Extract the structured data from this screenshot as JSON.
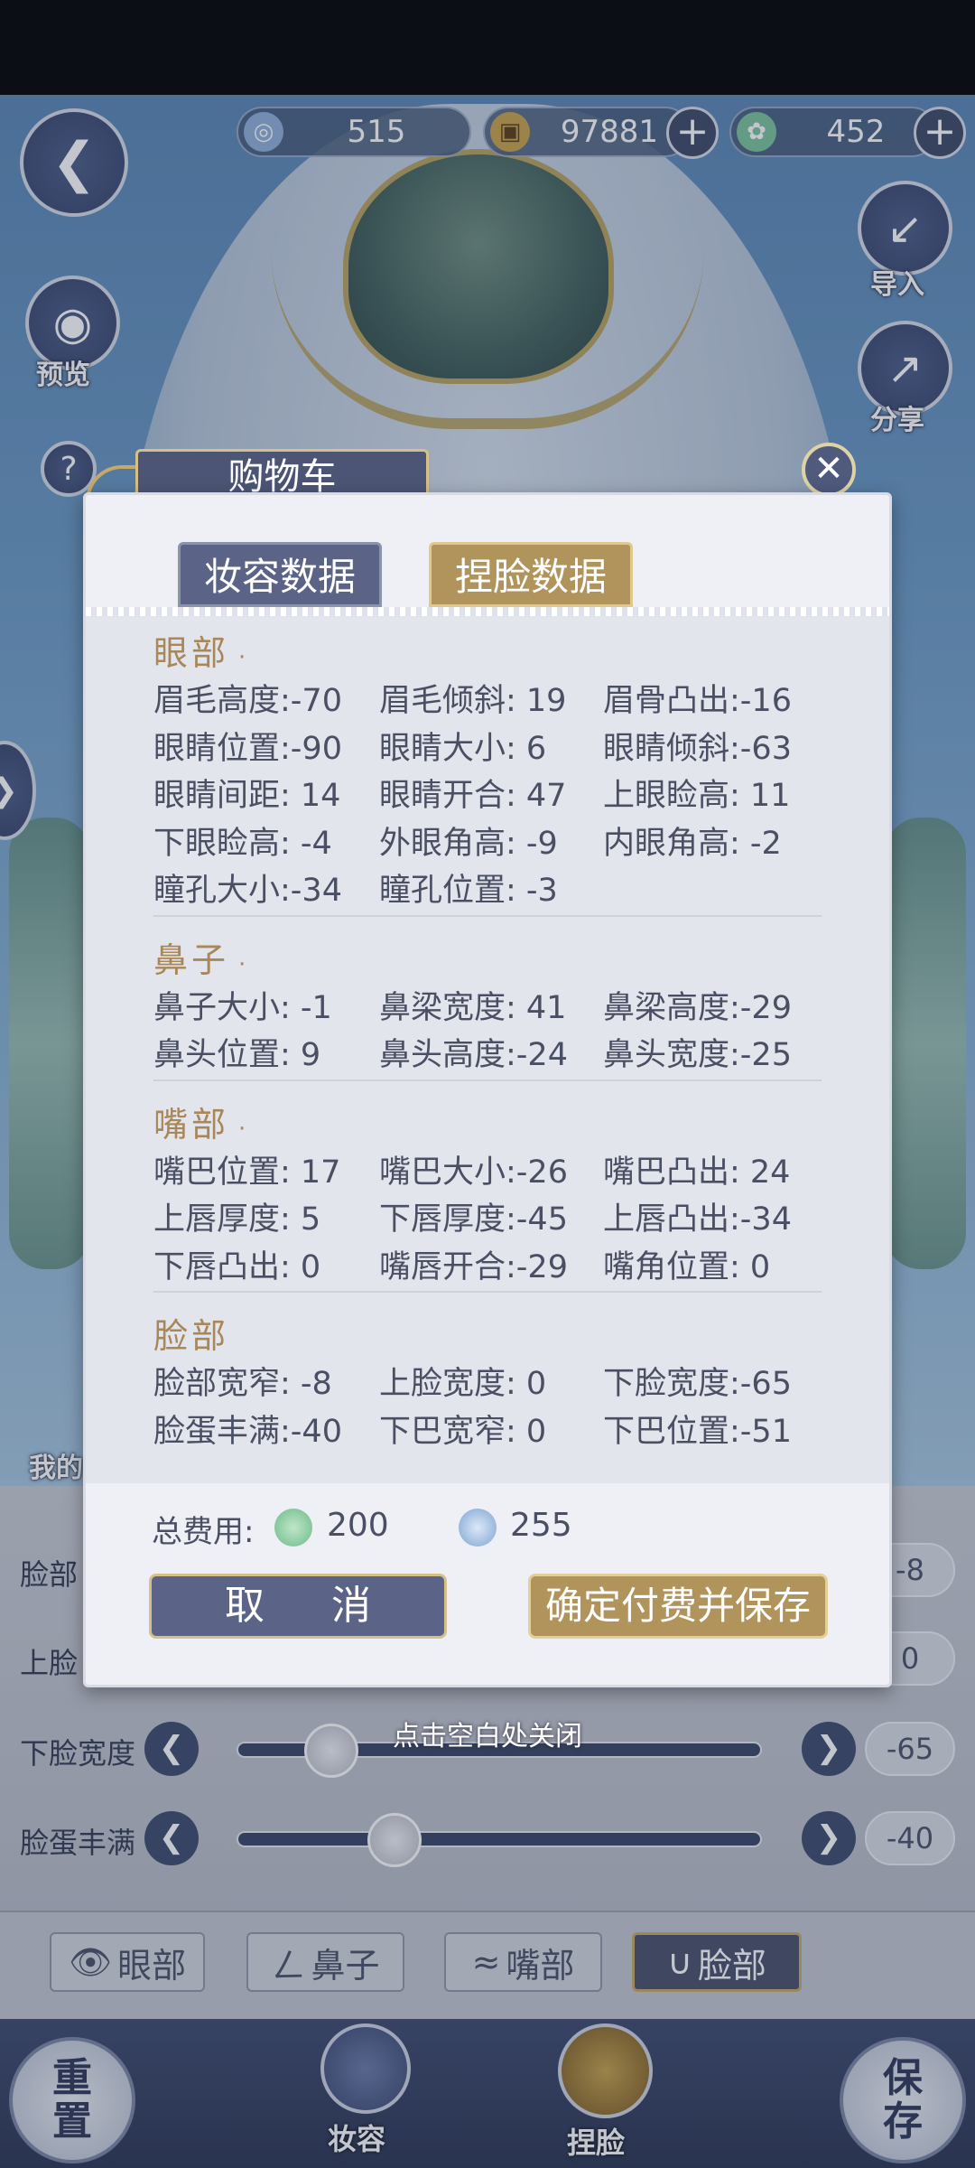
{
  "currency": [
    {
      "icon": "swirl-gem-icon",
      "value": "515"
    },
    {
      "icon": "coin-icon",
      "value": "97881"
    },
    {
      "icon": "jade-icon",
      "value": "452"
    }
  ],
  "side_buttons": {
    "preview": "预览",
    "import": "导入",
    "share": "分享",
    "help": "?",
    "mine_partial": "我的"
  },
  "dialog": {
    "title": "购物车",
    "close_symbol": "✕",
    "tabs": [
      "妆容数据",
      "捏脸数据"
    ],
    "active_tab": 1,
    "sections": [
      {
        "title": "眼部",
        "dot": "·",
        "rows": [
          [
            "眉毛高度:-70",
            "眉毛倾斜: 19",
            "眉骨凸出:-16"
          ],
          [
            "眼睛位置:-90",
            "眼睛大小:  6",
            "眼睛倾斜:-63"
          ],
          [
            "眼睛间距: 14",
            "眼睛开合: 47",
            "上眼睑高: 11"
          ],
          [
            "下眼睑高: -4",
            "外眼角高: -9",
            "内眼角高: -2"
          ],
          [
            "瞳孔大小:-34",
            "瞳孔位置: -3"
          ]
        ]
      },
      {
        "title": "鼻子",
        "dot": "·",
        "rows": [
          [
            "鼻子大小: -1",
            "鼻梁宽度: 41",
            "鼻梁高度:-29"
          ],
          [
            "鼻头位置:  9",
            "鼻头高度:-24",
            "鼻头宽度:-25"
          ]
        ]
      },
      {
        "title": "嘴部",
        "dot": "·",
        "rows": [
          [
            "嘴巴位置: 17",
            "嘴巴大小:-26",
            "嘴巴凸出: 24"
          ],
          [
            "上唇厚度:  5",
            "下唇厚度:-45",
            "上唇凸出:-34"
          ],
          [
            "下唇凸出:  0",
            "嘴唇开合:-29",
            "嘴角位置:  0"
          ]
        ]
      },
      {
        "title": "脸部",
        "dot": "",
        "rows": [
          [
            "脸部宽窄: -8",
            "上脸宽度:  0",
            "下脸宽度:-65"
          ],
          [
            "脸蛋丰满:-40",
            "下巴宽窄:  0",
            "下巴位置:-51"
          ]
        ]
      }
    ],
    "total_label": "总费用:",
    "total_jade": "200",
    "total_gem": "255",
    "cancel_label": "取 消",
    "confirm_label": "确定付费并保存"
  },
  "close_hint": "点击空白处关闭",
  "sliders": [
    {
      "label": "脸部",
      "value": "-8",
      "level": 0.46
    },
    {
      "label": "上脸",
      "value": "0",
      "level": 0.5
    },
    {
      "label": "下脸宽度",
      "value": "-65",
      "level": 0.18
    },
    {
      "label": "脸蛋丰满",
      "value": "-40",
      "level": 0.3
    }
  ],
  "part_tabs": [
    {
      "icon": "eye-icon",
      "label": "眼部"
    },
    {
      "icon": "nose-icon",
      "label": "鼻子"
    },
    {
      "icon": "mouth-icon",
      "label": "嘴部"
    },
    {
      "icon": "face-icon",
      "label": "脸部"
    }
  ],
  "active_part": 3,
  "bottom_nav": {
    "reset": "重置",
    "makeup": "妆容",
    "face": "捏脸",
    "save": "保存"
  }
}
